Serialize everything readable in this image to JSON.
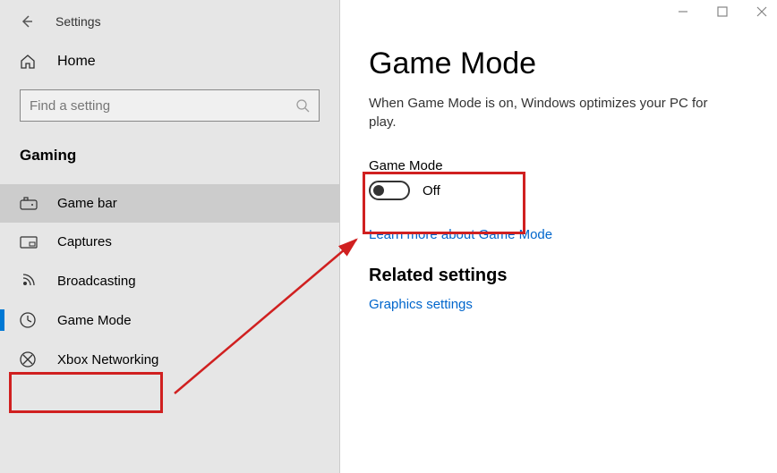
{
  "titlebar": {
    "title": "Settings"
  },
  "sidebar": {
    "home_label": "Home",
    "search_placeholder": "Find a setting",
    "category_label": "Gaming",
    "items": [
      {
        "label": "Game bar"
      },
      {
        "label": "Captures"
      },
      {
        "label": "Broadcasting"
      },
      {
        "label": "Game Mode"
      },
      {
        "label": "Xbox Networking"
      }
    ]
  },
  "main": {
    "title": "Game Mode",
    "description": "When Game Mode is on, Windows optimizes your PC for play.",
    "toggle_label": "Game Mode",
    "toggle_state": "Off",
    "learn_more": "Learn more about Game Mode",
    "related_header": "Related settings",
    "graphics_link": "Graphics settings"
  }
}
